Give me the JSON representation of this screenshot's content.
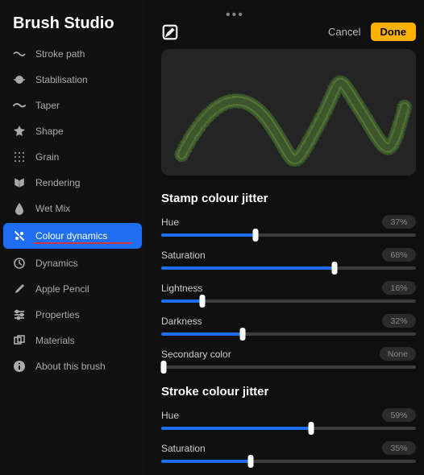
{
  "app_title": "Brush Studio",
  "sidebar": {
    "items": [
      {
        "label": "Stroke path",
        "icon": "stroke-path-icon"
      },
      {
        "label": "Stabilisation",
        "icon": "stabilisation-icon"
      },
      {
        "label": "Taper",
        "icon": "taper-icon"
      },
      {
        "label": "Shape",
        "icon": "shape-icon"
      },
      {
        "label": "Grain",
        "icon": "grain-icon"
      },
      {
        "label": "Rendering",
        "icon": "rendering-icon"
      },
      {
        "label": "Wet Mix",
        "icon": "wet-mix-icon"
      },
      {
        "label": "Colour dynamics",
        "icon": "colour-dynamics-icon",
        "active": true,
        "underline_color": "#d9333f"
      },
      {
        "label": "Dynamics",
        "icon": "dynamics-icon"
      },
      {
        "label": "Apple Pencil",
        "icon": "apple-pencil-icon"
      },
      {
        "label": "Properties",
        "icon": "properties-icon"
      },
      {
        "label": "Materials",
        "icon": "materials-icon"
      },
      {
        "label": "About this brush",
        "icon": "about-icon"
      }
    ]
  },
  "header": {
    "cancel_label": "Cancel",
    "done_label": "Done"
  },
  "sections": [
    {
      "title": "Stamp colour jitter",
      "sliders": [
        {
          "label": "Hue",
          "value": 37,
          "display": "37%"
        },
        {
          "label": "Saturation",
          "value": 68,
          "display": "68%"
        },
        {
          "label": "Lightness",
          "value": 16,
          "display": "16%"
        },
        {
          "label": "Darkness",
          "value": 32,
          "display": "32%"
        },
        {
          "label": "Secondary color",
          "value": 0,
          "display": "None"
        }
      ]
    },
    {
      "title": "Stroke colour jitter",
      "sliders": [
        {
          "label": "Hue",
          "value": 59,
          "display": "59%"
        },
        {
          "label": "Saturation",
          "value": 35,
          "display": "35%"
        }
      ]
    }
  ],
  "colors": {
    "accent": "#1E6EF2",
    "done_button": "#FFB100",
    "underline": "#d9333f"
  }
}
